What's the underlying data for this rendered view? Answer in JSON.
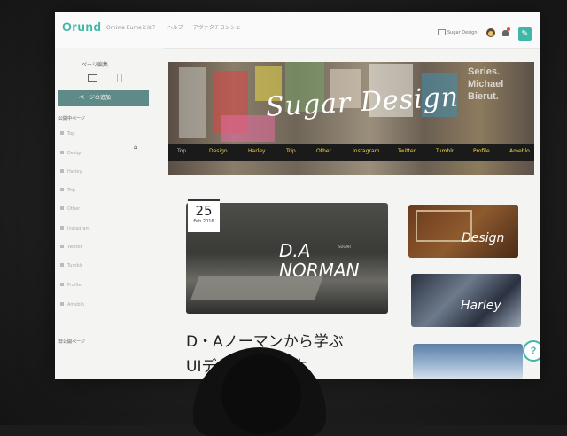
{
  "header": {
    "logo": "Orund",
    "nav": [
      "Omiwa Eumeとは？",
      "ヘルプ",
      "アヴァタチコンシェー"
    ],
    "user": "Sugar Design"
  },
  "sidebar": {
    "title": "ページ編集",
    "add_button": "ページの追加",
    "public_label": "公開中ページ",
    "private_label": "非公開ページ",
    "items": [
      "Top",
      "Design",
      "Harley",
      "Trip",
      "Other",
      "Instagram",
      "Twitter",
      "Tumblr",
      "Profile",
      "Ameblo"
    ]
  },
  "hero": {
    "title": "Sugar Design",
    "side_text": "Series. Michael Bierut.",
    "nav": [
      "Top",
      "Design",
      "Harley",
      "Trip",
      "Other",
      "Instagram",
      "Twitter",
      "Tumblr",
      "Profile",
      "Ameblo"
    ]
  },
  "article": {
    "day": "25",
    "month": "Feb.2016",
    "image_title": "D.A NORMAN",
    "image_sub": "SUGAR",
    "headline_line1": "D・Aノーマンから学ぶ",
    "headline_line2": "UIデザインの基本"
  },
  "cards": [
    {
      "label": "Design"
    },
    {
      "label": "Harley"
    }
  ],
  "help": "?"
}
